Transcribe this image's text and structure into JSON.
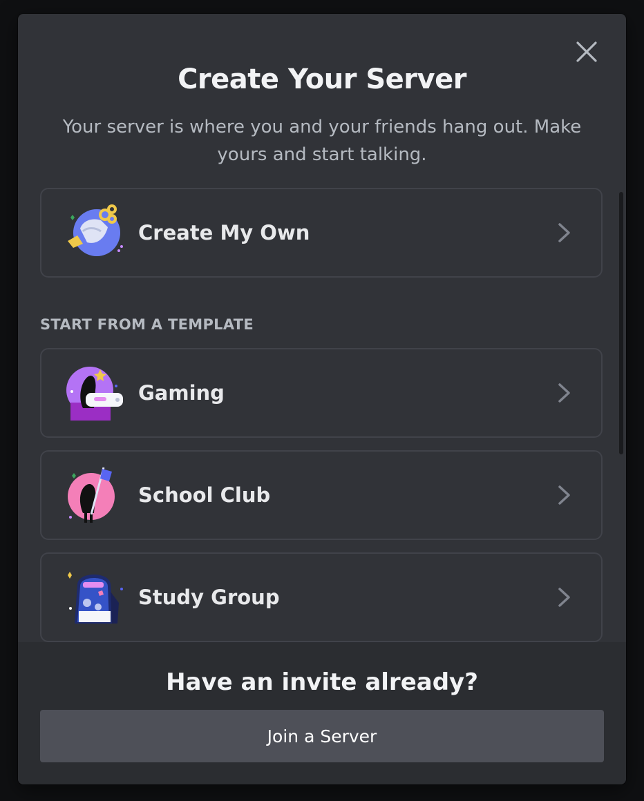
{
  "dialog": {
    "title": "Create Your Server",
    "subtitle": "Your server is where you and your friends hang out. Make yours and start talking."
  },
  "options": {
    "create_own": {
      "label": "Create My Own",
      "icon": "create-server-illustration"
    },
    "section_label": "START FROM A TEMPLATE",
    "templates": [
      {
        "label": "Gaming",
        "icon": "gaming-illustration"
      },
      {
        "label": "School Club",
        "icon": "school-club-illustration"
      },
      {
        "label": "Study Group",
        "icon": "study-group-illustration"
      }
    ]
  },
  "footer": {
    "title": "Have an invite already?",
    "join_label": "Join a Server"
  },
  "colors": {
    "modal_bg": "#313338",
    "footer_bg": "#2b2d31",
    "button_bg": "#4e5058",
    "text_primary": "#f2f3f5",
    "text_secondary": "#b5bac1"
  }
}
